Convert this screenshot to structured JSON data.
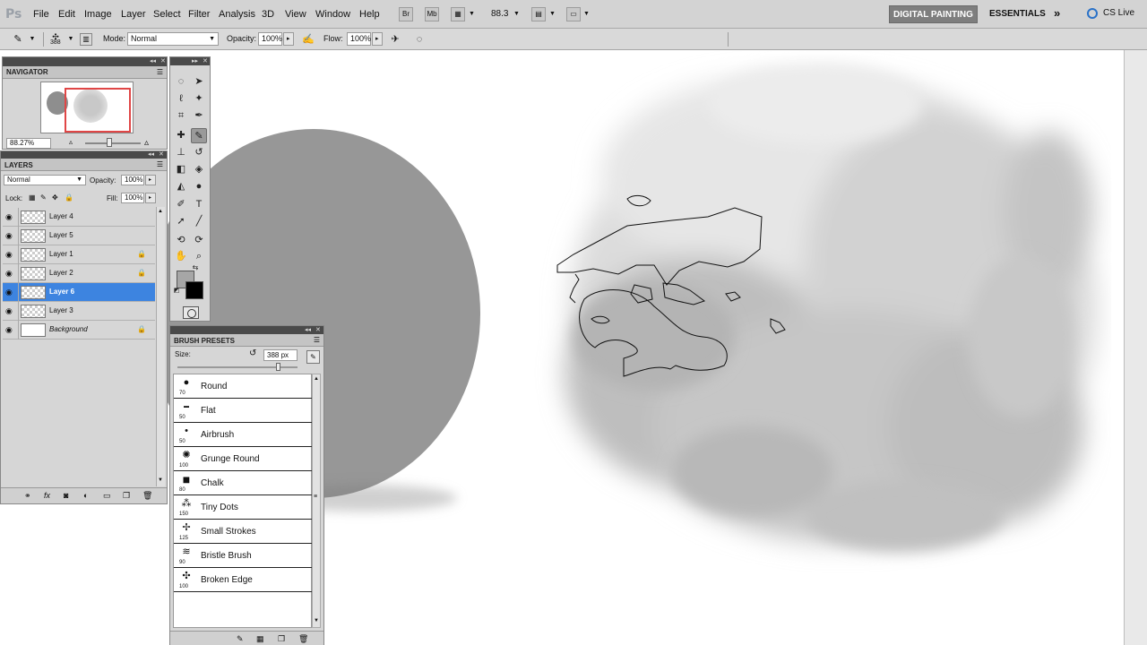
{
  "app": {
    "logo": "Ps"
  },
  "menu": [
    "File",
    "Edit",
    "Image",
    "Layer",
    "Select",
    "Filter",
    "Analysis",
    "3D",
    "View",
    "Window",
    "Help"
  ],
  "menubar": {
    "bridge_btn": "Br",
    "minibridge_btn": "Mb",
    "zoom": "88.3",
    "workspace_active": "DIGITAL PAINTING",
    "workspace_essentials": "ESSENTIALS",
    "workspace_more": "»",
    "cslive": "CS Live"
  },
  "options": {
    "brush_size": "388",
    "mode_label": "Mode:",
    "mode_value": "Normal",
    "opacity_label": "Opacity:",
    "opacity_value": "100%",
    "flow_label": "Flow:",
    "flow_value": "100%"
  },
  "navigator": {
    "title": "NAVIGATOR",
    "zoom": "88.27%"
  },
  "layers_panel": {
    "title": "LAYERS",
    "blend_mode": "Normal",
    "opacity_label": "Opacity:",
    "opacity_value": "100%",
    "lock_label": "Lock:",
    "fill_label": "Fill:",
    "fill_value": "100%",
    "layers": [
      {
        "name": "Layer 4",
        "locked": false,
        "selected": false
      },
      {
        "name": "Layer 5",
        "locked": false,
        "selected": false
      },
      {
        "name": "Layer 1",
        "locked": true,
        "selected": false
      },
      {
        "name": "Layer 2",
        "locked": true,
        "selected": false
      },
      {
        "name": "Layer 6",
        "locked": false,
        "selected": true
      },
      {
        "name": "Layer 3",
        "locked": false,
        "selected": false
      },
      {
        "name": "Background",
        "locked": true,
        "selected": false
      }
    ]
  },
  "brush_presets": {
    "title": "BRUSH PRESETS",
    "size_label": "Size:",
    "size_value": "388 px",
    "brushes": [
      {
        "name": "Round",
        "size": "70",
        "icon": "●"
      },
      {
        "name": "Flat",
        "size": "50",
        "icon": "▬"
      },
      {
        "name": "Airbrush",
        "size": "50",
        "icon": "•"
      },
      {
        "name": "Grunge Round",
        "size": "100",
        "icon": "✺"
      },
      {
        "name": "Chalk",
        "size": "80",
        "icon": "■"
      },
      {
        "name": "Tiny Dots",
        "size": "150",
        "icon": "⁂"
      },
      {
        "name": "Small Strokes",
        "size": "125",
        "icon": "✢"
      },
      {
        "name": "Bristle Brush",
        "size": "90",
        "icon": "≋"
      },
      {
        "name": "Broken Edge",
        "size": "100",
        "icon": "✣"
      }
    ]
  },
  "colors": {
    "foreground": "#a6a6a6",
    "background": "#000000",
    "selected_layer": "#3d84e0",
    "workspace_active": "#7e7e7e"
  },
  "icons": {
    "lock": "🔒",
    "eye": "◉"
  }
}
